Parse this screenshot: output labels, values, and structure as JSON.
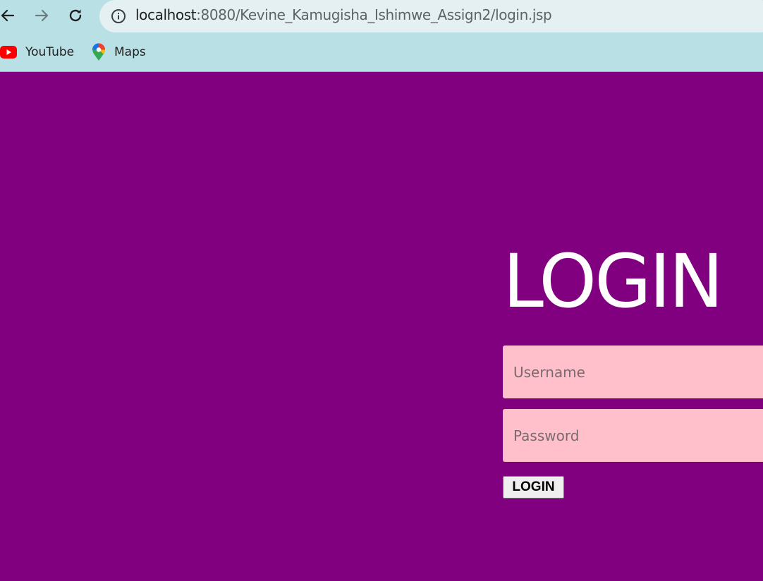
{
  "browser": {
    "url_host": "localhost",
    "url_path": ":8080/Kevine_Kamugisha_Ishimwe_Assign2/login.jsp",
    "nav_icons": [
      "back-arrow-icon",
      "forward-arrow-icon",
      "reload-icon",
      "info-icon"
    ],
    "bookmarks": [
      {
        "label": "YouTube",
        "icon": "youtube-icon"
      },
      {
        "label": "Maps",
        "icon": "maps-pin-icon"
      }
    ]
  },
  "page": {
    "title": "LOGIN",
    "username_placeholder": "Username",
    "password_placeholder": "Password",
    "submit_label": "LOGIN"
  },
  "colors": {
    "page_background": "#800080",
    "field_background": "#ffc0cb",
    "title_color": "#ffffff",
    "chrome_background": "#b9e0e5"
  }
}
